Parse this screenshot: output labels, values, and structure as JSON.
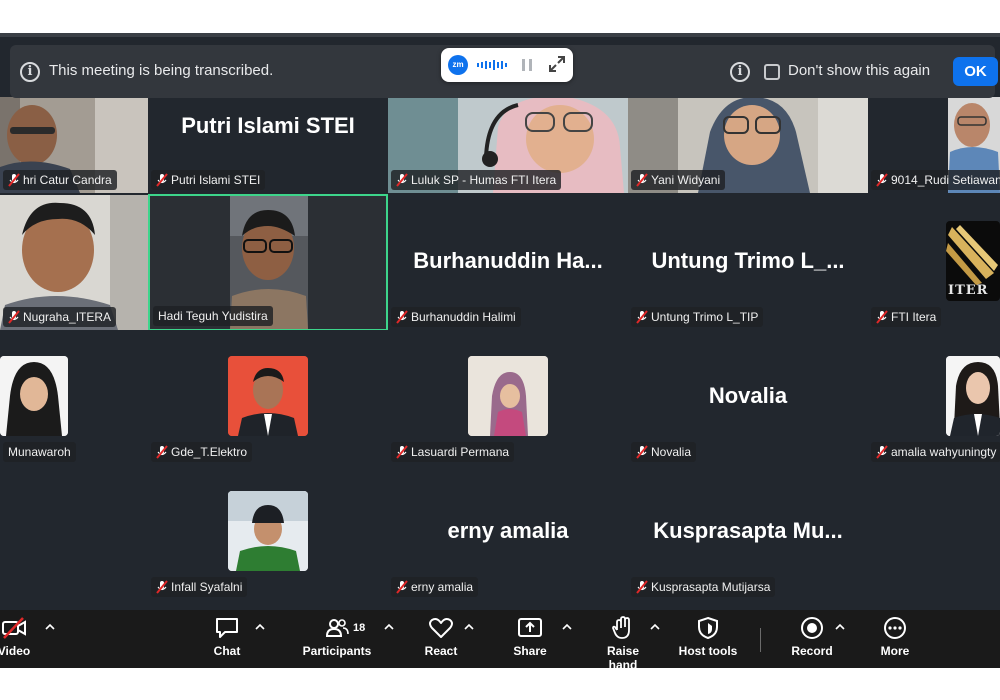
{
  "banner": {
    "message": "This meeting is being transcribed.",
    "dont_show": "Don't show this again",
    "ok": "OK"
  },
  "mini": {
    "logo": "zm"
  },
  "tiles": {
    "t1": {
      "name": "hri Catur Candra"
    },
    "t2": {
      "name": "Putri Islami STEI",
      "big": "Putri Islami STEI"
    },
    "t3": {
      "name": "Luluk SP - Humas FTI Itera"
    },
    "t4": {
      "name": "Yani Widyani"
    },
    "t5": {
      "name": "9014_Rudi Setiawan"
    },
    "t6": {
      "name": "Nugraha_ITERA"
    },
    "t7": {
      "name": "Hadi Teguh Yudistira"
    },
    "t8": {
      "name": "Burhanuddin Halimi",
      "big": "Burhanuddin  Ha..."
    },
    "t9": {
      "name": "Untung Trimo L_TIP",
      "big": "Untung  Trimo  L_..."
    },
    "t10": {
      "name": "FTI Itera",
      "logo_text": "ITER"
    },
    "t11": {
      "name": "Munawaroh"
    },
    "t12": {
      "name": "Gde_T.Elektro"
    },
    "t13": {
      "name": "Lasuardi Permana"
    },
    "t14": {
      "name": "Novalia",
      "big": "Novalia"
    },
    "t15": {
      "name": "amalia wahyuningty"
    },
    "t16": {
      "name": "Infall Syafalni"
    },
    "t17": {
      "name": "erny amalia",
      "big": "erny amalia"
    },
    "t18": {
      "name": "Kusprasapta Mutijarsa",
      "big": "Kusprasapta  Mu..."
    }
  },
  "toolbar": {
    "video": "Video",
    "chat": "Chat",
    "participants": "Participants",
    "participants_count": "18",
    "react": "React",
    "share": "Share",
    "raise_hand": "Raise hand",
    "host_tools": "Host tools",
    "record": "Record",
    "more": "More"
  },
  "colors": {
    "accent": "#0e72ed",
    "active_border": "#3dd58b",
    "mute_red": "#e02828",
    "background": "#22272e"
  }
}
